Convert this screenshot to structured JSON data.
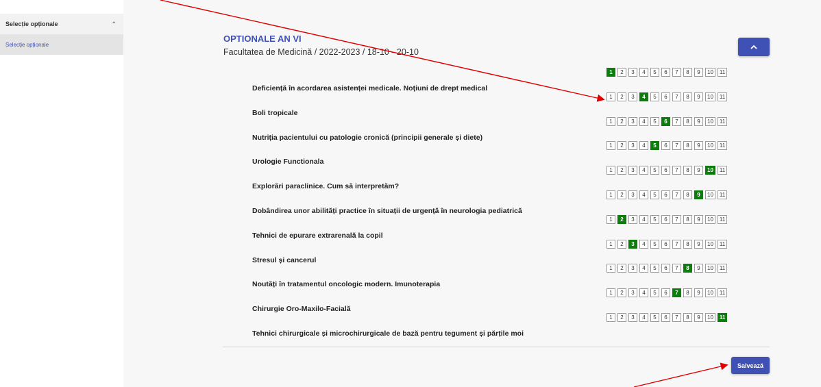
{
  "sidebar": {
    "header_label": "Selecție opționale",
    "header_icon": "chevron-up-icon",
    "items": [
      {
        "label": "Selecție opționale"
      }
    ]
  },
  "page": {
    "title": "OPTIONALE AN VI",
    "subtitle": "Facultatea de Medicină / 2022-2023 / 18-10 - 20-10",
    "collapse_icon": "chevron-up-icon"
  },
  "pager_numbers": [
    "1",
    "2",
    "3",
    "4",
    "5",
    "6",
    "7",
    "8",
    "9",
    "10",
    "11"
  ],
  "courses": [
    {
      "name": "Deficiență în acordarea asistenței medicale. Noțiuni de drept medical",
      "selected": 1
    },
    {
      "name": "Boli tropicale",
      "selected": 4
    },
    {
      "name": "Nutriția pacientului cu patologie cronică (principii generale și diete)",
      "selected": 6
    },
    {
      "name": "Urologie Functionala",
      "selected": 5
    },
    {
      "name": "Explorări paraclinice. Cum să interpretăm?",
      "selected": 10
    },
    {
      "name": "Dobândirea unor abilități practice în situații de urgență în neurologia pediatrică",
      "selected": 9
    },
    {
      "name": "Tehnici de epurare extrarenală la copil",
      "selected": 2
    },
    {
      "name": "Stresul și cancerul",
      "selected": 3
    },
    {
      "name": "Noutăți în tratamentul oncologic modern. Imunoterapia",
      "selected": 8
    },
    {
      "name": "Chirurgie Oro-Maxilo-Facială",
      "selected": 7
    },
    {
      "name": "Tehnici chirurgicale și microchirurgicale de bază pentru tegument și părțile moi",
      "selected": 11
    }
  ],
  "actions": {
    "save_label": "Salvează"
  },
  "colors": {
    "accent": "#3f51b5",
    "selected": "#0a7d0a",
    "annotation_arrow": "#e00000"
  }
}
